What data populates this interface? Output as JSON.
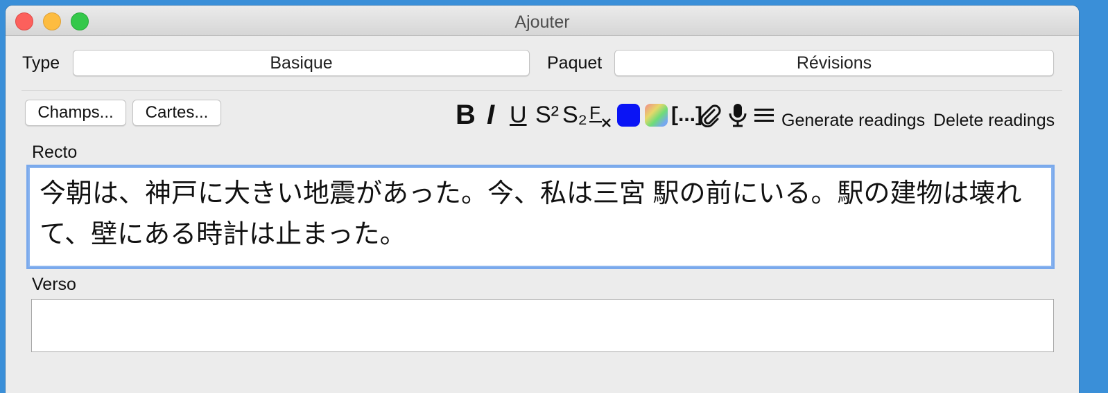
{
  "window": {
    "title": "Ajouter"
  },
  "type_field": {
    "label": "Type",
    "value": "Basique"
  },
  "deck_field": {
    "label": "Paquet",
    "value": "Révisions"
  },
  "buttons": {
    "fields": "Champs...",
    "cards": "Cartes..."
  },
  "toolbar": {
    "bold": "B",
    "italic": "I",
    "underline": "U",
    "superscript": "S²",
    "subscript": "S₂",
    "cloze": "[...]",
    "text_color": "#0a14f5",
    "generate_readings": "Generate readings",
    "delete_readings": "Delete readings"
  },
  "front": {
    "label": "Recto",
    "text": "今朝は、神戸に大きい地震があった。今、私は三宮 駅の前にいる。駅の建物は壊れて、壁にある時計は止まった。"
  },
  "back": {
    "label": "Verso",
    "text": ""
  }
}
